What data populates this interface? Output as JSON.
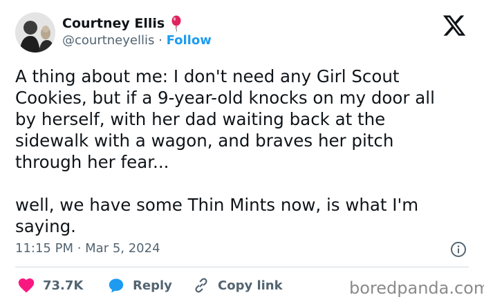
{
  "author": {
    "display_name": "Courtney Ellis",
    "badge_icon": "balloon-icon",
    "handle": "@courtneyellis",
    "separator": "·",
    "follow_label": "Follow"
  },
  "tweet": {
    "text": "A thing about me: I don't need any Girl Scout\nCookies, but if a 9-year-old knocks on my door all\nby herself, with her dad waiting back at the\nsidewalk with a wagon, and braves her pitch\nthrough her fear...\n\nwell, we have some Thin Mints now, is what I'm\nsaying.",
    "timestamp": "11:15 PM · Mar 5, 2024"
  },
  "actions": {
    "likes_count": "73.7K",
    "reply_label": "Reply",
    "copy_link_label": "Copy link"
  },
  "watermark": "boredpanda.com",
  "colors": {
    "link_blue": "#1d9bf0",
    "like_pink": "#f91880",
    "muted_text": "#536471",
    "badge_red": "#e0245e"
  }
}
